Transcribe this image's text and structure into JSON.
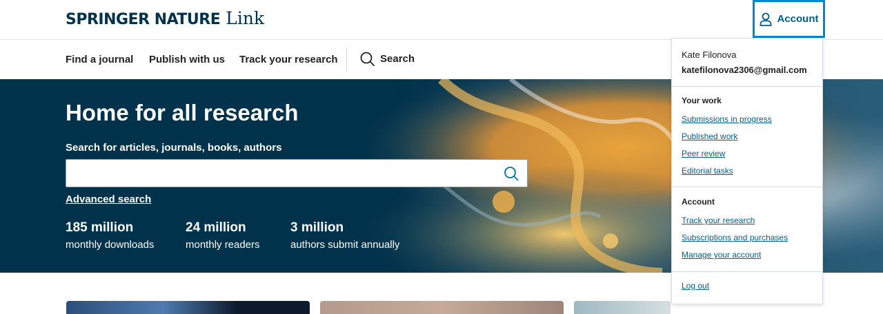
{
  "header": {
    "brand": "SPRINGER NATURE",
    "brand_suffix": "Link",
    "account_label": "Account"
  },
  "nav": {
    "items": [
      "Find a journal",
      "Publish with us",
      "Track your research"
    ],
    "search_label": "Search"
  },
  "hero": {
    "title": "Home for all research",
    "search_label": "Search for articles, journals, books, authors",
    "search_value": "",
    "advanced_search": "Advanced search",
    "stats": [
      {
        "number": "185 million",
        "label": "monthly downloads"
      },
      {
        "number": "24 million",
        "label": "monthly readers"
      },
      {
        "number": "3 million",
        "label": "authors submit annually"
      }
    ]
  },
  "account_menu": {
    "user_name": "Kate Filonova",
    "user_email": "katefilonova2306@gmail.com",
    "your_work_heading": "Your work",
    "your_work_links": [
      "Submissions in progress",
      "Published work",
      "Peer review",
      "Editorial tasks"
    ],
    "account_heading": "Account",
    "account_links": [
      "Track your research",
      "Subscriptions and purchases",
      "Manage your account"
    ],
    "logout": "Log out"
  },
  "colors": {
    "brand_dark": "#01324b",
    "link_blue": "#025e8d",
    "accent_blue": "#0088cc"
  },
  "icons": {
    "account": "user-icon",
    "search": "search-icon"
  }
}
